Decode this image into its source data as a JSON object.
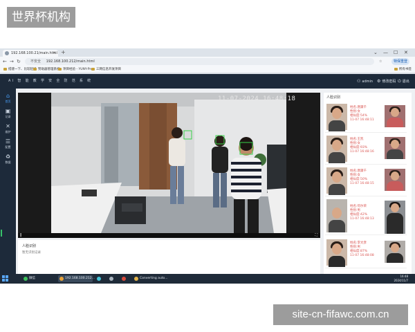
{
  "watermark": {
    "top": "世界杯机构",
    "bottom": "site-cn-fifawc.com.cn"
  },
  "browser": {
    "tab_title": "192.168.100.21/main.html",
    "new_tab": "+",
    "window_controls": [
      "⌄",
      "—",
      "☐",
      "✕"
    ],
    "nav_icons": [
      "←",
      "→",
      "↻"
    ],
    "security_label": "不安全",
    "url": "192.168.100.212/main.html",
    "login_button": "特保重登",
    "bookmarks": [
      "搭建一下、比较轻娱",
      "赞助器管理系统",
      "项目经验 - YUNY-Pro",
      "三网信息开发项目"
    ],
    "bookmarks_right": "所有书签"
  },
  "app": {
    "title": "AI 智 能 教 学 安 全 防 范 系 统",
    "user": "admin",
    "user_icon": "person-icon",
    "change_password": "修改密码",
    "logout": "退出",
    "sidebar": [
      {
        "label": "首页",
        "icon": "home-icon",
        "active": true
      },
      {
        "label": "记录",
        "icon": "record-icon",
        "active": false
      },
      {
        "label": "维护",
        "icon": "wrench-icon",
        "active": false
      },
      {
        "label": "配置",
        "icon": "sliders-icon",
        "active": false
      },
      {
        "label": "数据",
        "icon": "recycle-icon",
        "active": false
      }
    ],
    "video": {
      "timestamp": "11-07-2024 16:48:18",
      "pause_icon": "‖",
      "fullscreen_icon": "⛶"
    },
    "records": {
      "title": "人脸识别",
      "empty_text": "暂无识别记录"
    },
    "people": {
      "title": "人脸识别",
      "items": [
        {
          "name": "姓名:唐黛千",
          "gender": "性别:女",
          "similarity": "相似度:54%",
          "time": "11-07 16:48:11"
        },
        {
          "name": "姓名:王凯",
          "gender": "性别:女",
          "similarity": "相似度:93%",
          "time": "11-07 16:48:16"
        },
        {
          "name": "姓名:唐黛千",
          "gender": "性别:女",
          "similarity": "相似度:50%",
          "time": "11-07 16:48:15"
        },
        {
          "name": "姓名:何尔荣",
          "gender": "性别:男",
          "similarity": "相似度:42%",
          "time": "11-07 16:48:13"
        },
        {
          "name": "姓名:李文彦",
          "gender": "性别:男",
          "similarity": "相似度:87%",
          "time": "11-07 16:48:08"
        }
      ]
    }
  },
  "taskbar": {
    "apps": [
      "微信",
      "192.168.100.212...",
      "Screenshot...",
      "Converting auto..."
    ],
    "clock_time": "16:48",
    "clock_date": "2024/11/7"
  }
}
